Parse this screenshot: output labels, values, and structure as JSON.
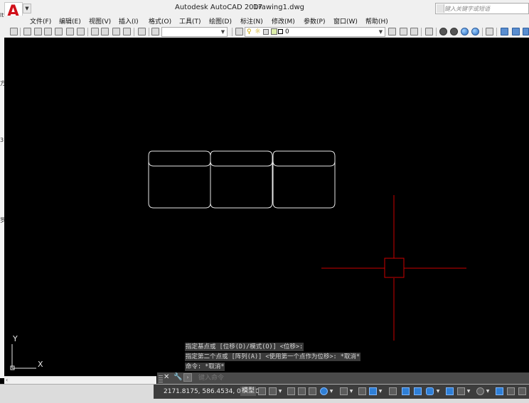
{
  "app": {
    "logo_letter": "A",
    "title_app": "Autodesk AutoCAD 2017",
    "title_file": "Drawing1.dwg",
    "search_placeholder": "键入关键字或短语"
  },
  "menu": [
    "文件(F)",
    "编辑(E)",
    "视图(V)",
    "插入(I)",
    "格式(O)",
    "工具(T)",
    "绘图(D)",
    "标注(N)",
    "修改(M)",
    "参数(P)",
    "窗口(W)",
    "帮助(H)"
  ],
  "toolbar": {
    "layer_name": "0",
    "layer_state_icons": [
      "bulb-icon",
      "sun-icon",
      "lock-icon",
      "color-swatch-icon"
    ]
  },
  "left_edge_chars": [
    "lt",
    "方",
    "3",
    "罗"
  ],
  "command_history": [
    "指定基点或 [位移(D)/模式(O)] <位移>:",
    "指定第二个点或 [阵列(A)] <使用第一个点作为位移>: *取消*",
    "命令: *取消*"
  ],
  "command_input": {
    "placeholder": "键入命令"
  },
  "ucs": {
    "x_label": "X",
    "y_label": "Y"
  },
  "status": {
    "coordinates": "2171.8175, 586.4534, 0.0000",
    "model_label": "模型"
  },
  "colors": {
    "canvas": "#000000",
    "crosshair": "#cc0000",
    "geometry": "#ffffff",
    "command_panel": "#4a4a4a",
    "status_bar": "#3d3d3d",
    "status_on": "#2f7fd6",
    "logo_red": "#d0101a"
  }
}
